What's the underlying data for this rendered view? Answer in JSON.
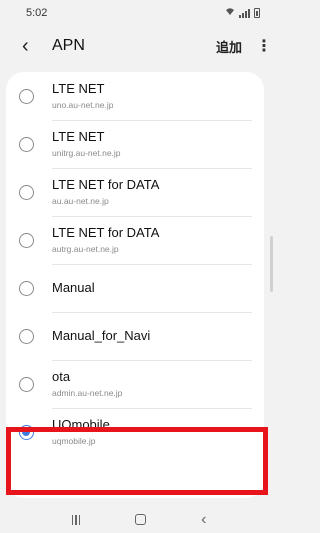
{
  "status_bar": {
    "time": "5:02",
    "wifi_icon": "wifi-icon",
    "signal_icon": "signal-icon",
    "battery_icon": "battery-icon"
  },
  "app_bar": {
    "back_icon": "back-arrow-icon",
    "title": "APN",
    "add_label": "追加",
    "more_icon": "more-vert-icon"
  },
  "apn_list": [
    {
      "name": "LTE NET",
      "url": "uno.au-net.ne.jp",
      "selected": false
    },
    {
      "name": "LTE NET",
      "url": "unitrg.au-net.ne.jp",
      "selected": false
    },
    {
      "name": "LTE NET for DATA",
      "url": "au.au-net.ne.jp",
      "selected": false
    },
    {
      "name": "LTE NET for DATA",
      "url": "autrg.au-net.ne.jp",
      "selected": false
    },
    {
      "name": "Manual",
      "url": "",
      "selected": false
    },
    {
      "name": "Manual_for_Navi",
      "url": "",
      "selected": false
    },
    {
      "name": "ota",
      "url": "admin.au-net.ne.jp",
      "selected": false
    },
    {
      "name": "UQmobile",
      "url": "uqmobile.jp",
      "selected": true
    }
  ],
  "nav_bar": {
    "recents_icon": "recents-icon",
    "home_icon": "home-icon",
    "back_icon": "back-icon"
  },
  "colors": {
    "selected_radio": "#3e7be0",
    "highlight": "#e8141b",
    "background": "#f2f2f2"
  }
}
